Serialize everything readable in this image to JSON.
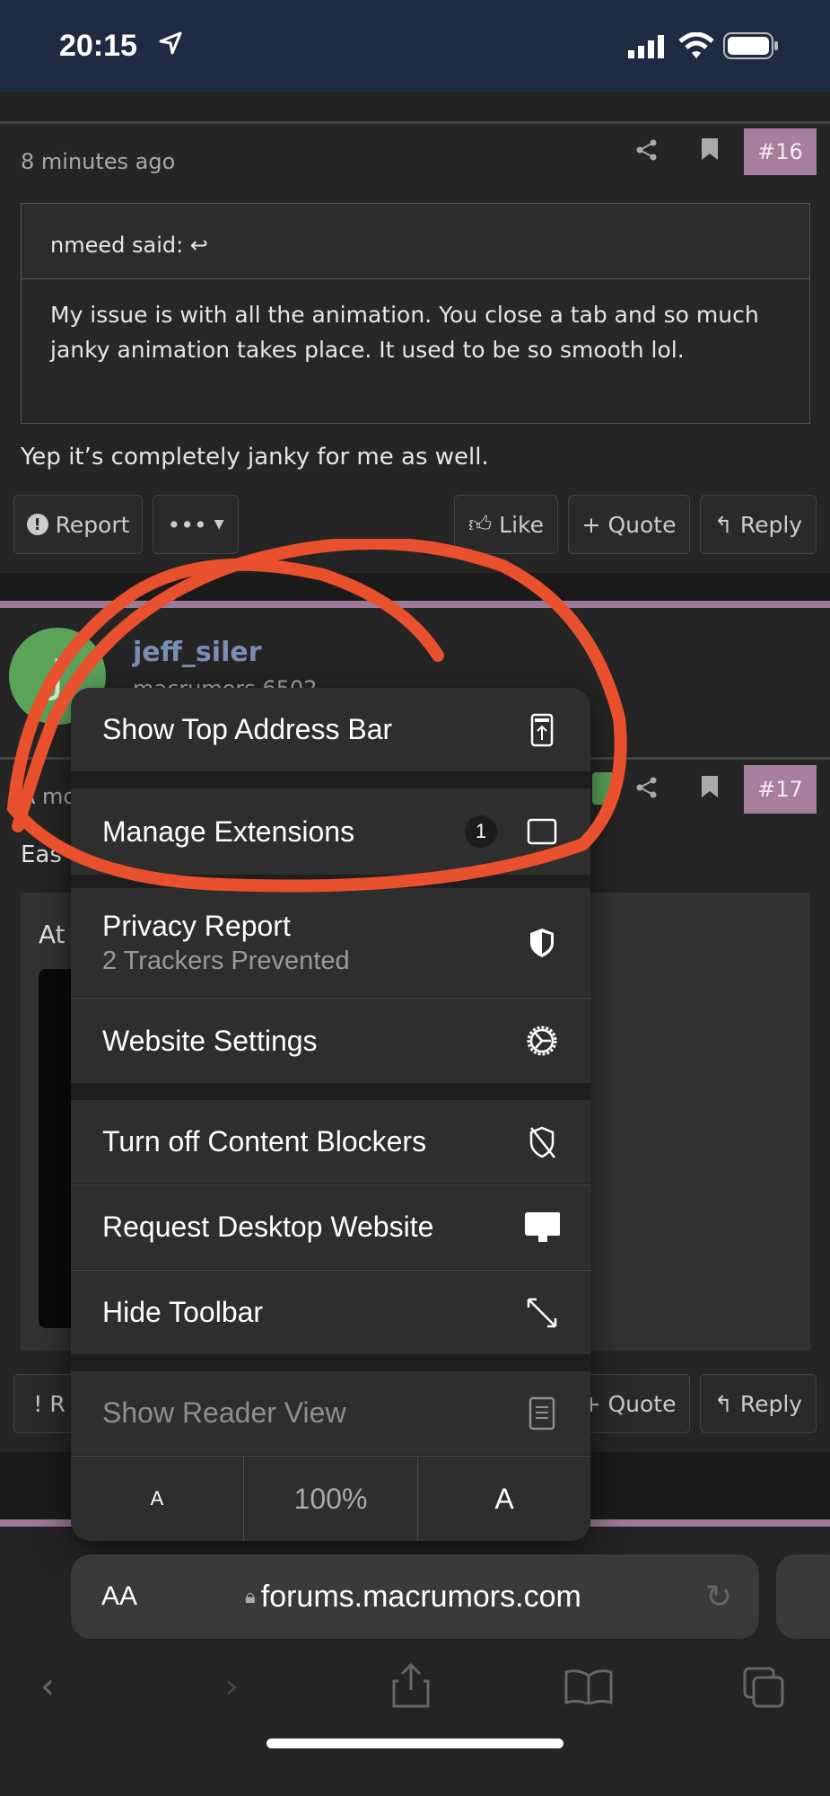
{
  "status": {
    "time": "20:15",
    "icons": [
      "location-arrow",
      "signal",
      "wifi",
      "battery"
    ]
  },
  "post16": {
    "time": "8 minutes ago",
    "number": "#16",
    "quote_author": "nmeed said:",
    "quote_text": "My issue is with all the animation. You close a tab and so much janky animation takes place. It used to be so smooth lol.",
    "body": "Yep it’s completely janky for me as well.",
    "buttons": {
      "report": "Report",
      "more": "•••",
      "like": "Like",
      "quote": "Quote",
      "reply": "Reply"
    }
  },
  "post17": {
    "username": "jeff_siler",
    "user_title": "macrumors 6502",
    "avatar_letter": "J",
    "time": "A mo",
    "number": "#17",
    "body_fragment": "Eas",
    "quote_fragment": "At",
    "buttons": {
      "report": "R",
      "quote": "Quote",
      "reply": "Reply"
    }
  },
  "menu": {
    "items": [
      {
        "label": "Show Top Address Bar",
        "icon": "top-address-bar-icon"
      },
      {
        "label": "Manage Extensions",
        "badge": "1",
        "icon": "extensions-icon"
      },
      {
        "label": "Privacy Report",
        "sub": "2 Trackers Prevented",
        "icon": "shield-icon"
      },
      {
        "label": "Website Settings",
        "icon": "gear-icon"
      },
      {
        "label": "Turn off Content Blockers",
        "icon": "shield-slash-icon"
      },
      {
        "label": "Request Desktop Website",
        "icon": "desktop-icon"
      },
      {
        "label": "Hide Toolbar",
        "icon": "expand-arrows-icon"
      },
      {
        "label": "Show Reader View",
        "icon": "reader-icon",
        "disabled": true
      }
    ],
    "zoom": {
      "smaller": "A",
      "level": "100%",
      "larger": "A"
    }
  },
  "address_bar": {
    "aa": "AA",
    "url": "forums.macrumors.com"
  },
  "colors": {
    "annotation": "#e8502e",
    "badge": "#a57f9c",
    "username": "#7b8fb5",
    "avatar": "#5ba45a"
  }
}
